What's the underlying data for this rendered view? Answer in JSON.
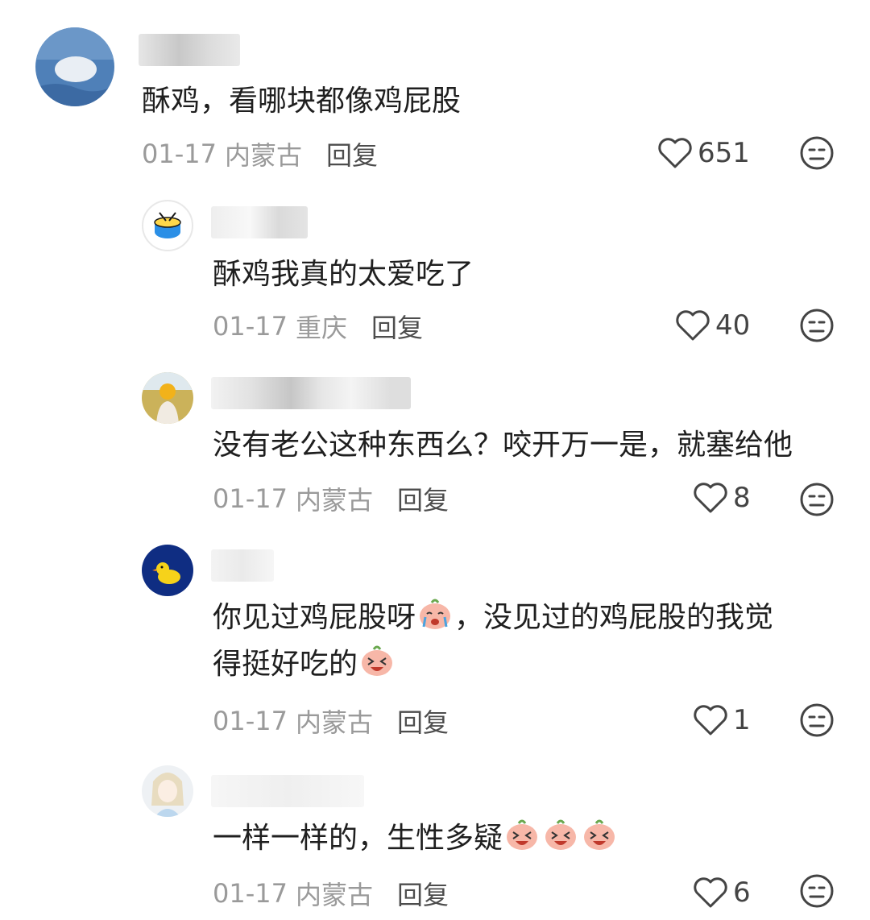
{
  "comments": [
    {
      "text": "酥鸡，看哪块都像鸡屁股",
      "date": "01-17",
      "location": "内蒙古",
      "reply_label": "回复",
      "likes": "651"
    },
    {
      "text": "酥鸡我真的太爱吃了",
      "date": "01-17",
      "location": "重庆",
      "reply_label": "回复",
      "likes": "40"
    },
    {
      "text": "没有老公这种东西么？咬开万一是，就塞给他",
      "date": "01-17",
      "location": "内蒙古",
      "reply_label": "回复",
      "likes": "8"
    },
    {
      "text_line1": "你见过鸡屁股呀",
      "text_line1b": "，没见过的鸡屁股的我觉",
      "text_line2": "得挺好吃的",
      "date": "01-17",
      "location": "内蒙古",
      "reply_label": "回复",
      "likes": "1"
    },
    {
      "text": "一样一样的，生性多疑",
      "date": "01-17",
      "location": "内蒙古",
      "reply_label": "回复",
      "likes": "6"
    }
  ],
  "icons": {
    "like": "heart-outline-icon",
    "react": "neutral-face-icon",
    "emoji": "peach-face-emoji"
  }
}
